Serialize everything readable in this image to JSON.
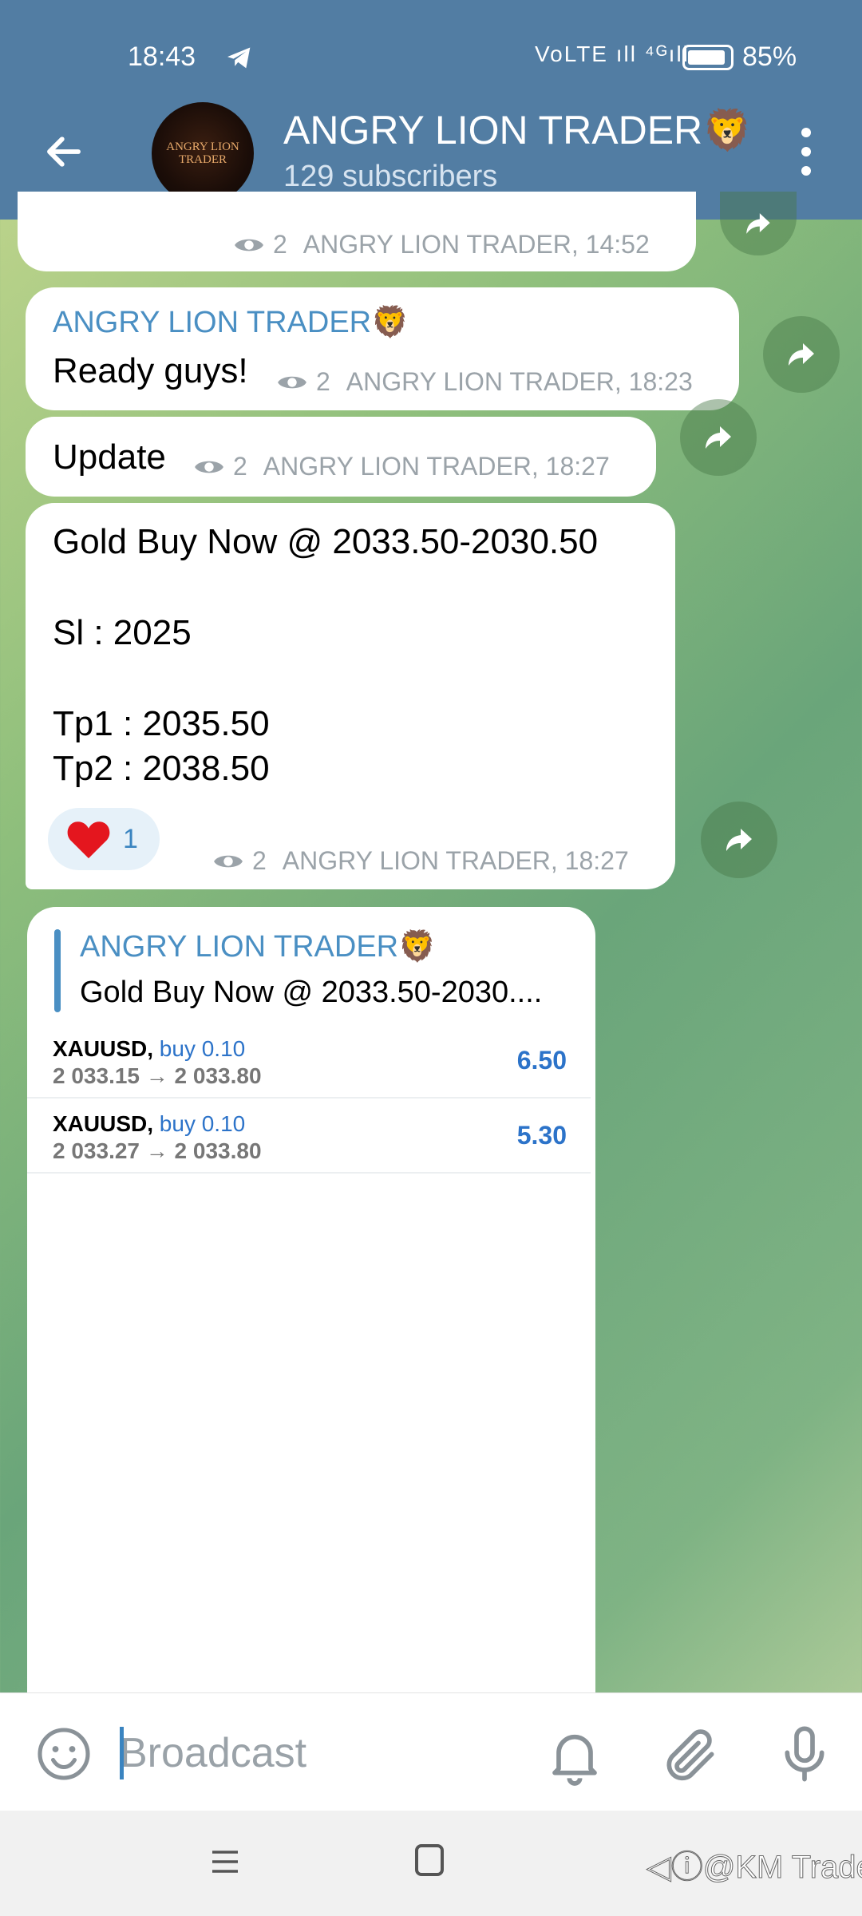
{
  "status_bar": {
    "time": "18:43",
    "network_icons": "VoLTE ıll ⁴ᴳıll",
    "battery": "85%"
  },
  "header": {
    "title": "ANGRY LION TRADER🦁",
    "subtitle": "129 subscribers",
    "avatar_text_line1": "ANGRY LION",
    "avatar_text_line2": "TRADER"
  },
  "messages": [
    {
      "views": "2",
      "signature": "ANGRY LION TRADER, 14:52"
    },
    {
      "author": "ANGRY LION TRADER🦁",
      "text": "Ready guys!",
      "views": "2",
      "signature": "ANGRY LION TRADER, 18:23"
    },
    {
      "text": "Update",
      "views": "2",
      "signature": "ANGRY LION TRADER, 18:27"
    },
    {
      "lines": [
        "Gold Buy Now @ 2033.50-2030.50",
        "Sl : 2025",
        "Tp1 : 2035.50",
        "Tp2 : 2038.50"
      ],
      "reaction_emoji": "❤️",
      "reaction_count": "1",
      "views": "2",
      "signature": "ANGRY LION TRADER, 18:27"
    }
  ],
  "card": {
    "quote_author": "ANGRY LION TRADER🦁",
    "quote_text": "Gold Buy Now @ 2033.50-2030....",
    "trades": [
      {
        "symbol": "XAUUSD,",
        "side": "buy 0.10",
        "range": "2 033.15 → 2 033.80",
        "profit": "6.50"
      },
      {
        "symbol": "XAUUSD,",
        "side": "buy 0.10",
        "range": "2 033.27 → 2 033.80",
        "profit": "5.30"
      }
    ]
  },
  "input": {
    "placeholder": "Broadcast"
  },
  "watermark": "◁ⓘ@KM Trader",
  "colors": {
    "header_bg": "#527da3",
    "accent": "#4a8fc3",
    "profit": "#2c73c9"
  }
}
